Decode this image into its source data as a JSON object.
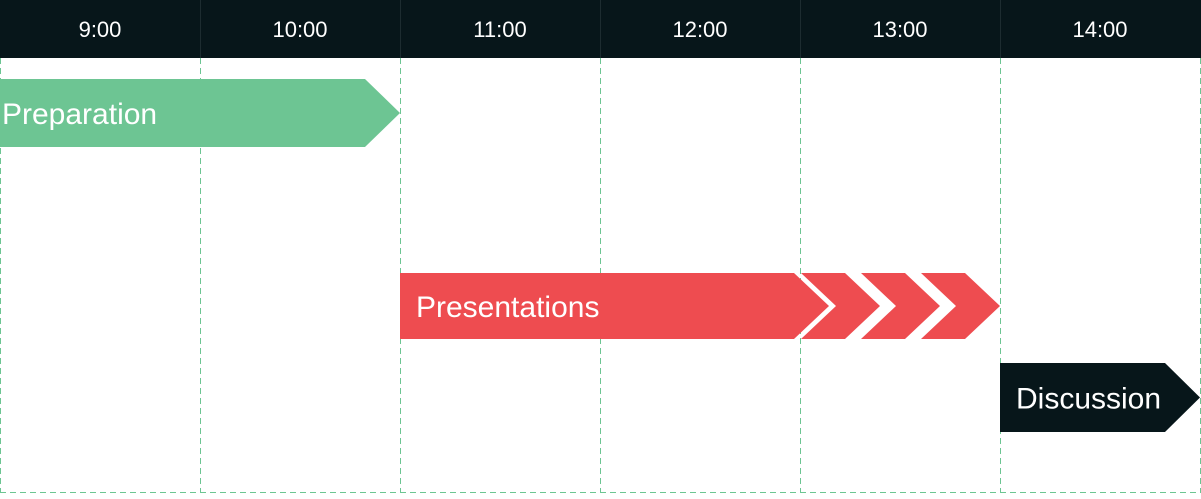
{
  "timeline": {
    "hours": [
      "9:00",
      "10:00",
      "11:00",
      "12:00",
      "13:00",
      "14:00"
    ],
    "colors": {
      "header_bg": "#07161a",
      "header_text": "#ffffff",
      "grid": "#6cc592",
      "background": "#ffffff"
    },
    "tasks": [
      {
        "label": "Preparation",
        "start": "9:00",
        "end": "11:00",
        "color": "#6dc593",
        "continuation": false
      },
      {
        "label": "Presentations",
        "start": "11:00",
        "end": "14:00",
        "color": "#ee4c50",
        "continuation": true
      },
      {
        "label": "Discussion",
        "start": "14:00",
        "end": "15:00",
        "color": "#07161a",
        "continuation": false
      }
    ]
  }
}
